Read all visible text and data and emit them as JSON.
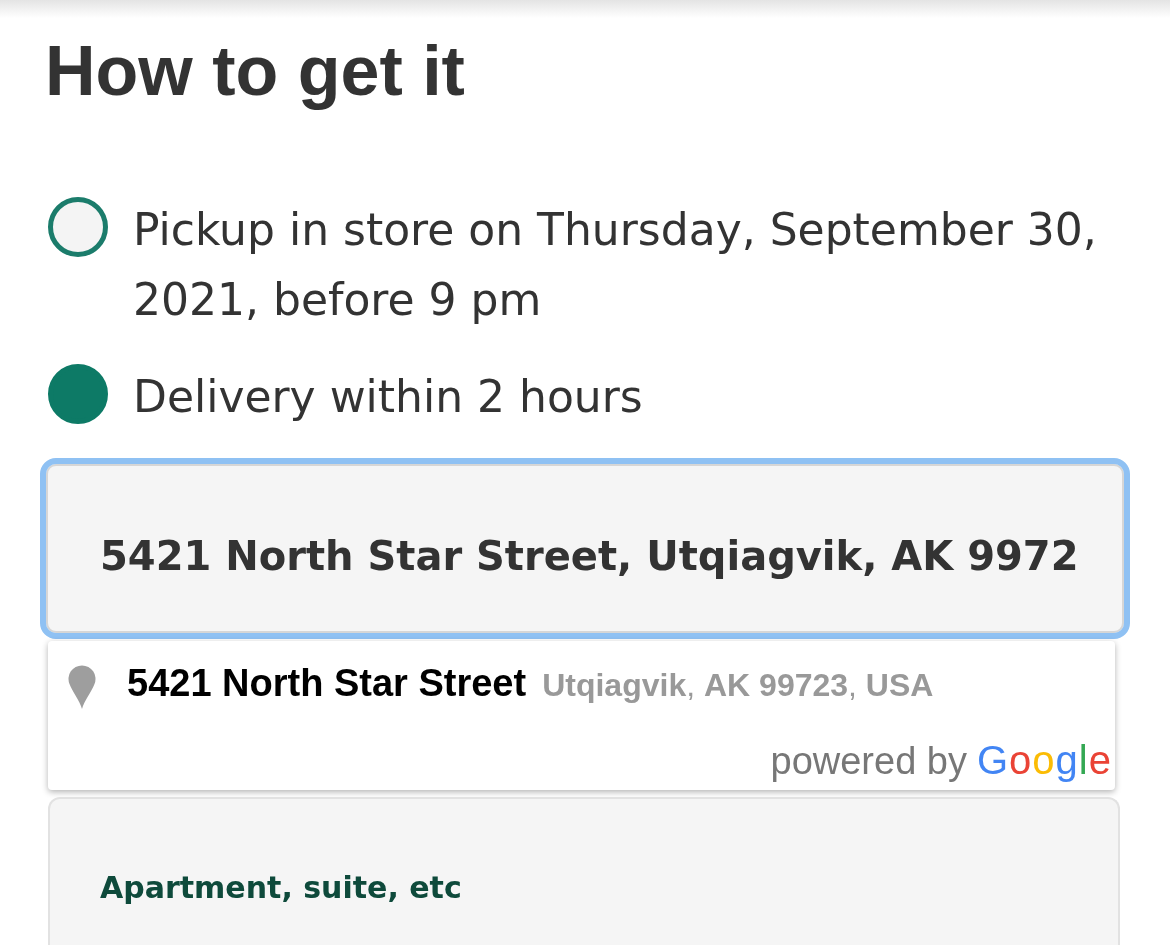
{
  "heading": "How to get it",
  "fulfillment_options": [
    {
      "label": "Pickup in store on Thursday, September 30, 2021, before 9 pm",
      "selected": false
    },
    {
      "label": "Delivery within 2 hours",
      "selected": true
    }
  ],
  "address_field": {
    "value": "5421 North Star Street, Utqiagvik, AK 9972",
    "focused": true
  },
  "suggestions": [
    {
      "main_text": "5421 North Star Street",
      "secondary_text": "**Utqiagvik**, **AK 99723**, **USA**"
    }
  ],
  "attribution": {
    "text": "powered by",
    "logo": "Google"
  },
  "apartment_field": {
    "placeholder": "Apartment, suite, etc"
  }
}
